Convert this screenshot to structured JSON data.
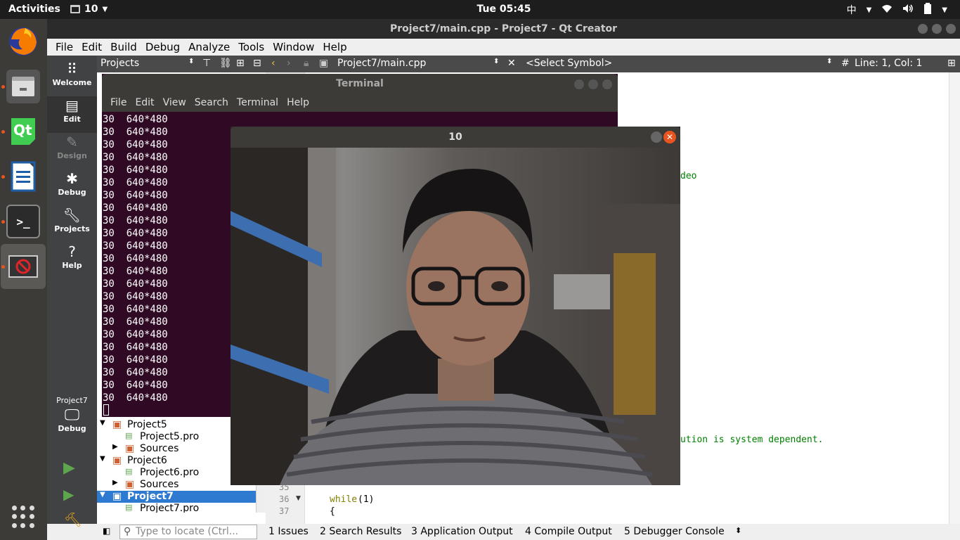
{
  "topbar": {
    "activities": "Activities",
    "window_app": "10",
    "clock": "Tue 05:45",
    "input_method": "中"
  },
  "qt": {
    "title": "Project7/main.cpp - Project7 - Qt Creator",
    "menu": [
      "File",
      "Edit",
      "Build",
      "Debug",
      "Analyze",
      "Tools",
      "Window",
      "Help"
    ],
    "toolbar": {
      "projects": "Projects",
      "file": "Project7/main.cpp",
      "symbol": "<Select Symbol>",
      "hash": "#",
      "position": "Line: 1, Col: 1"
    },
    "modes": [
      {
        "label": "Welcome",
        "icon": "grid-icon"
      },
      {
        "label": "Edit",
        "icon": "document-icon"
      },
      {
        "label": "Design",
        "icon": "pencil-icon"
      },
      {
        "label": "Debug",
        "icon": "bug-icon"
      },
      {
        "label": "Projects",
        "icon": "wrench-icon"
      },
      {
        "label": "Help",
        "icon": "help-icon"
      }
    ],
    "kit": {
      "project": "Project7",
      "mode": "Debug"
    },
    "tree": [
      {
        "label": "Project5",
        "kind": "project"
      },
      {
        "label": "Project5.pro",
        "kind": "file"
      },
      {
        "label": "Sources",
        "kind": "folder"
      },
      {
        "label": "Project6",
        "kind": "project"
      },
      {
        "label": "Project6.pro",
        "kind": "file"
      },
      {
        "label": "Sources",
        "kind": "folder"
      },
      {
        "label": "Project7",
        "kind": "project"
      },
      {
        "label": "Project7.pro",
        "kind": "file"
      }
    ],
    "code": {
      "fragment1": "deo",
      "fragment2": "ution is system dependent.",
      "line35": "35",
      "line36": "36",
      "line37": "37",
      "code36_kw": "while",
      "code36_rest": " (1)",
      "code37": "{"
    },
    "status": {
      "locate_placeholder": "Type to locate (Ctrl...",
      "tabs": [
        "1  Issues",
        "2  Search Results",
        "3  Application Output",
        "4  Compile Output",
        "5  Debugger Console"
      ]
    }
  },
  "terminal": {
    "title": "Terminal",
    "menu": [
      "File",
      "Edit",
      "View",
      "Search",
      "Terminal",
      "Help"
    ],
    "lines": [
      "30  640*480",
      "30  640*480",
      "30  640*480",
      "30  640*480",
      "30  640*480",
      "30  640*480",
      "30  640*480",
      "30  640*480",
      "30  640*480",
      "30  640*480",
      "30  640*480",
      "30  640*480",
      "30  640*480",
      "30  640*480",
      "30  640*480",
      "30  640*480",
      "30  640*480",
      "30  640*480",
      "30  640*480",
      "30  640*480",
      "30  640*480",
      "30  640*480",
      "30  640*480"
    ]
  },
  "camera": {
    "title": "10"
  },
  "colors": {
    "ubuntu_orange": "#e95420",
    "terminal_bg": "#300a24",
    "qt_selection": "#2f7ad1",
    "qt_green": "#5ea64e"
  }
}
